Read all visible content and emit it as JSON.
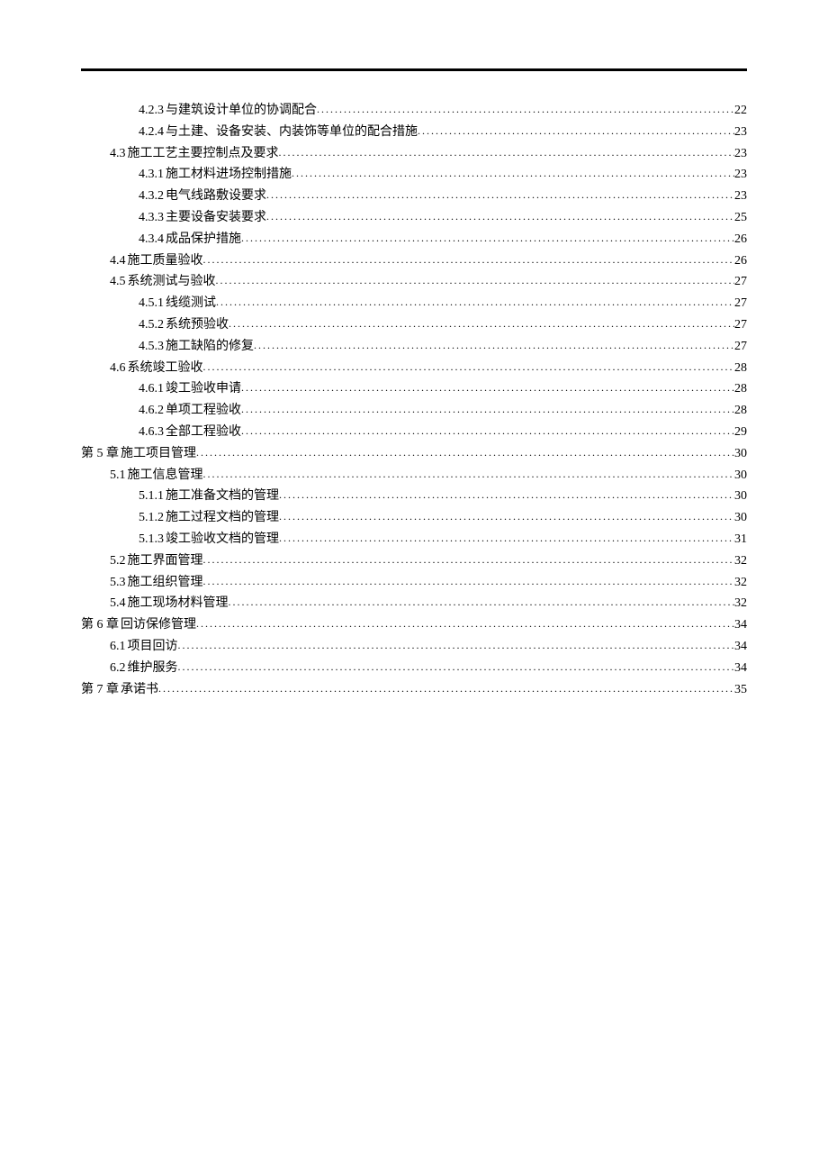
{
  "toc": [
    {
      "level": 2,
      "num": "4.2.3",
      "title": " 与建筑设计单位的协调配合",
      "page": "22"
    },
    {
      "level": 2,
      "num": "4.2.4",
      "title": " 与土建、设备安装、内装饰等单位的配合措施",
      "page": "23"
    },
    {
      "level": 1,
      "num": "4.3",
      "title": " 施工工艺主要控制点及要求",
      "page": "23"
    },
    {
      "level": 2,
      "num": "4.3.1",
      "title": " 施工材料进场控制措施",
      "page": "23"
    },
    {
      "level": 2,
      "num": "4.3.2",
      "title": " 电气线路敷设要求",
      "page": "23"
    },
    {
      "level": 2,
      "num": "4.3.3",
      "title": " 主要设备安装要求",
      "page": "25"
    },
    {
      "level": 2,
      "num": "4.3.4",
      "title": " 成品保护措施",
      "page": "26"
    },
    {
      "level": 1,
      "num": "4.4",
      "title": " 施工质量验收",
      "page": "26"
    },
    {
      "level": 1,
      "num": "4.5",
      "title": " 系统测试与验收",
      "page": "27"
    },
    {
      "level": 2,
      "num": "4.5.1",
      "title": " 线缆测试",
      "page": "27"
    },
    {
      "level": 2,
      "num": "4.5.2",
      "title": " 系统预验收",
      "page": "27"
    },
    {
      "level": 2,
      "num": "4.5.3",
      "title": " 施工缺陷的修复",
      "page": "27"
    },
    {
      "level": 1,
      "num": "4.6",
      "title": " 系统竣工验收",
      "page": "28"
    },
    {
      "level": 2,
      "num": "4.6.1",
      "title": " 竣工验收申请",
      "page": "28"
    },
    {
      "level": 2,
      "num": "4.6.2",
      "title": " 单项工程验收",
      "page": "28"
    },
    {
      "level": 2,
      "num": "4.6.3",
      "title": " 全部工程验收",
      "page": "29"
    },
    {
      "level": 0,
      "num": "第 5 章",
      "title": " 施工项目管理",
      "page": "30"
    },
    {
      "level": 1,
      "num": "5.1",
      "title": " 施工信息管理",
      "page": "30"
    },
    {
      "level": 2,
      "num": "5.1.1",
      "title": " 施工准备文档的管理",
      "page": "30"
    },
    {
      "level": 2,
      "num": "5.1.2",
      "title": " 施工过程文档的管理",
      "page": "30"
    },
    {
      "level": 2,
      "num": "5.1.3",
      "title": " 竣工验收文档的管理",
      "page": "31"
    },
    {
      "level": 1,
      "num": "5.2",
      "title": " 施工界面管理",
      "page": "32"
    },
    {
      "level": 1,
      "num": "5.3",
      "title": " 施工组织管理",
      "page": "32"
    },
    {
      "level": 1,
      "num": "5.4",
      "title": " 施工现场材料管理",
      "page": "32"
    },
    {
      "level": 0,
      "num": "第 6 章",
      "title": " 回访保修管理",
      "page": "34"
    },
    {
      "level": 1,
      "num": "6.1",
      "title": " 项目回访",
      "page": "34"
    },
    {
      "level": 1,
      "num": "6.2",
      "title": " 维护服务",
      "page": "34"
    },
    {
      "level": 0,
      "num": "第 7 章",
      "title": " 承诺书",
      "page": "35"
    }
  ]
}
